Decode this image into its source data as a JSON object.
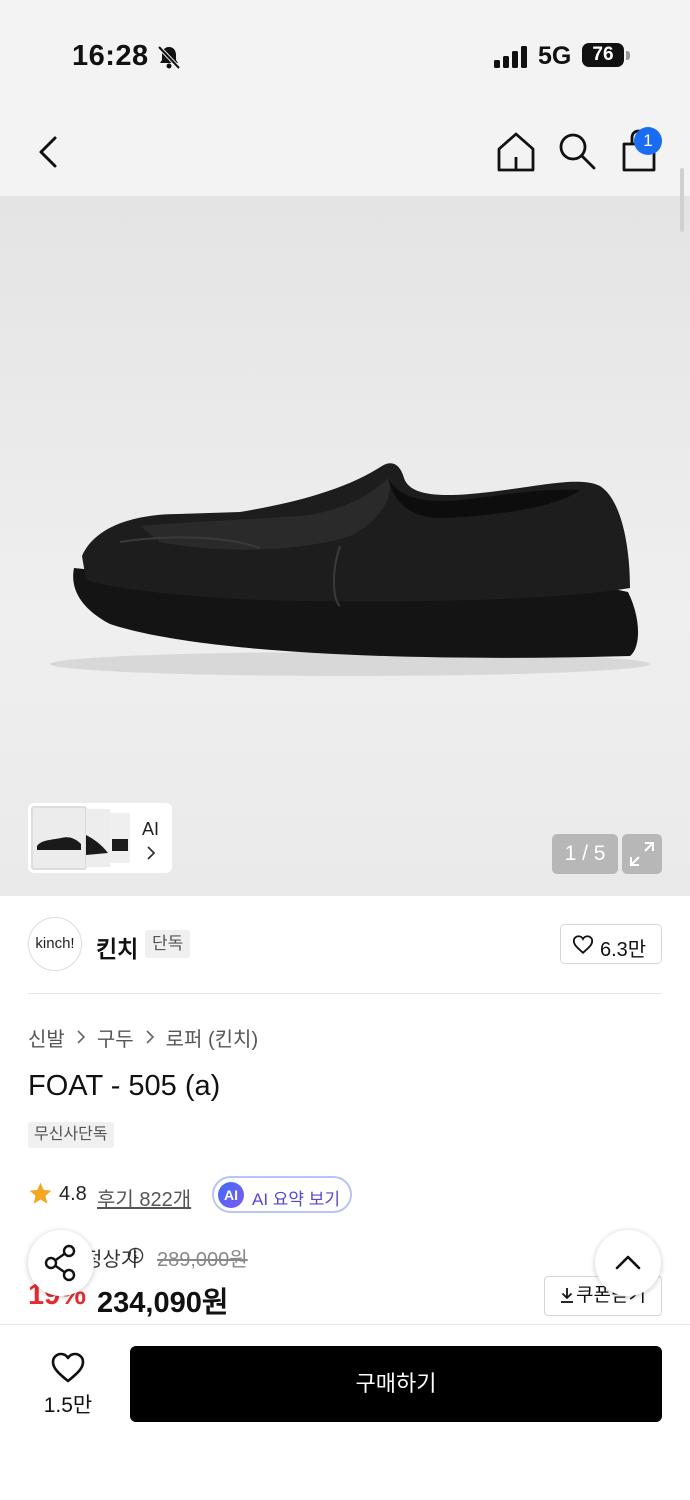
{
  "status_bar": {
    "time": "16:28",
    "network": "5G",
    "battery": "76"
  },
  "nav": {
    "cart_count": "1"
  },
  "gallery": {
    "ai_label": "AI",
    "page_indicator": "1 / 5"
  },
  "brand": {
    "logo_text": "kinch!",
    "name": "킨치",
    "tag": "단독",
    "like_count": "6.3만"
  },
  "product": {
    "breadcrumb": [
      "신발",
      "구두",
      "로퍼 (킨치)"
    ],
    "title": "FOAT - 505 (a)",
    "exclusive_tag": "무신사단독",
    "rating": "4.8",
    "reviews": "후기 822개",
    "ai_badge": "AI",
    "ai_summary_label": "AI 요약 보기",
    "original_price_label": "정상가",
    "original_price": "289,000원",
    "discount_rate": "19%",
    "sale_price": "234,090원",
    "coupon_label": "쿠폰받기"
  },
  "bottom_bar": {
    "wish_count": "1.5만",
    "buy_label": "구매하기"
  },
  "colors": {
    "discount": "#e8292f",
    "badge_blue": "#1a6df2",
    "ai_purple": "#5446d6",
    "buy_button": "#000000"
  }
}
